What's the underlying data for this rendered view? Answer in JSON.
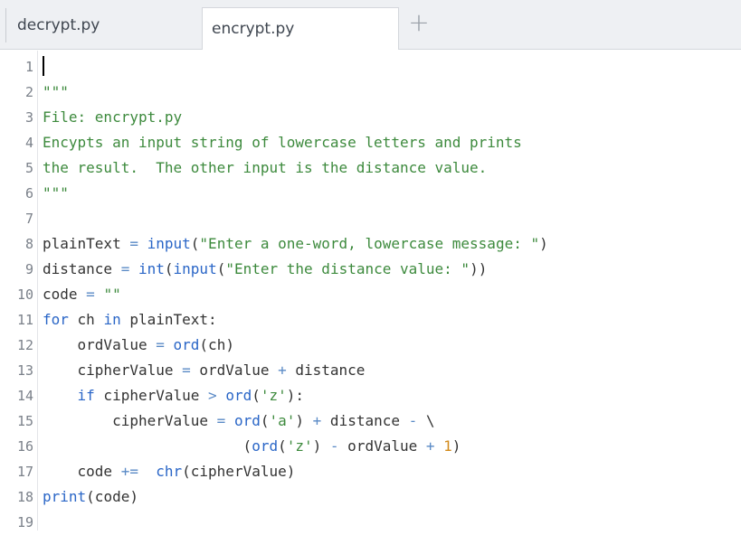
{
  "tabs": [
    {
      "label": "decrypt.py",
      "active": false
    },
    {
      "label": "encrypt.py",
      "active": true
    }
  ],
  "add_tab_icon": "plus-icon",
  "colors": {
    "keyword": "#2a66c7",
    "string": "#3d8a3d",
    "number": "#d28a1a",
    "plain": "#333333",
    "line_number": "#7b818a"
  },
  "lines": [
    {
      "n": "1",
      "tokens": []
    },
    {
      "n": "2",
      "tokens": [
        {
          "t": "\"\"\"",
          "c": "str"
        }
      ]
    },
    {
      "n": "3",
      "tokens": [
        {
          "t": "File: encrypt.py",
          "c": "str"
        }
      ]
    },
    {
      "n": "4",
      "tokens": [
        {
          "t": "Encypts an input string of lowercase letters and prints",
          "c": "str"
        }
      ]
    },
    {
      "n": "5",
      "tokens": [
        {
          "t": "the result.  The other input is the distance value.",
          "c": "str"
        }
      ]
    },
    {
      "n": "6",
      "tokens": [
        {
          "t": "\"\"\"",
          "c": "str"
        }
      ]
    },
    {
      "n": "7",
      "tokens": []
    },
    {
      "n": "8",
      "tokens": [
        {
          "t": "plainText ",
          "c": "plain"
        },
        {
          "t": "=",
          "c": "op"
        },
        {
          "t": " ",
          "c": "plain"
        },
        {
          "t": "input",
          "c": "kw"
        },
        {
          "t": "(",
          "c": "plain"
        },
        {
          "t": "\"Enter a one-word, lowercase message: \"",
          "c": "str"
        },
        {
          "t": ")",
          "c": "plain"
        }
      ]
    },
    {
      "n": "9",
      "tokens": [
        {
          "t": "distance ",
          "c": "plain"
        },
        {
          "t": "=",
          "c": "op"
        },
        {
          "t": " ",
          "c": "plain"
        },
        {
          "t": "int",
          "c": "kw"
        },
        {
          "t": "(",
          "c": "plain"
        },
        {
          "t": "input",
          "c": "kw"
        },
        {
          "t": "(",
          "c": "plain"
        },
        {
          "t": "\"Enter the distance value: \"",
          "c": "str"
        },
        {
          "t": "))",
          "c": "plain"
        }
      ]
    },
    {
      "n": "10",
      "tokens": [
        {
          "t": "code ",
          "c": "plain"
        },
        {
          "t": "=",
          "c": "op"
        },
        {
          "t": " ",
          "c": "plain"
        },
        {
          "t": "\"\"",
          "c": "str"
        }
      ]
    },
    {
      "n": "11",
      "tokens": [
        {
          "t": "for",
          "c": "kw"
        },
        {
          "t": " ch ",
          "c": "plain"
        },
        {
          "t": "in",
          "c": "kw"
        },
        {
          "t": " plainText:",
          "c": "plain"
        }
      ]
    },
    {
      "n": "12",
      "tokens": [
        {
          "t": "    ordValue ",
          "c": "plain"
        },
        {
          "t": "=",
          "c": "op"
        },
        {
          "t": " ",
          "c": "plain"
        },
        {
          "t": "ord",
          "c": "kw"
        },
        {
          "t": "(ch)",
          "c": "plain"
        }
      ]
    },
    {
      "n": "13",
      "tokens": [
        {
          "t": "    cipherValue ",
          "c": "plain"
        },
        {
          "t": "=",
          "c": "op"
        },
        {
          "t": " ordValue ",
          "c": "plain"
        },
        {
          "t": "+",
          "c": "op"
        },
        {
          "t": " distance",
          "c": "plain"
        }
      ]
    },
    {
      "n": "14",
      "tokens": [
        {
          "t": "    ",
          "c": "plain"
        },
        {
          "t": "if",
          "c": "kw"
        },
        {
          "t": " cipherValue ",
          "c": "plain"
        },
        {
          "t": ">",
          "c": "op"
        },
        {
          "t": " ",
          "c": "plain"
        },
        {
          "t": "ord",
          "c": "kw"
        },
        {
          "t": "(",
          "c": "plain"
        },
        {
          "t": "'z'",
          "c": "str"
        },
        {
          "t": "):",
          "c": "plain"
        }
      ]
    },
    {
      "n": "15",
      "tokens": [
        {
          "t": "        cipherValue ",
          "c": "plain"
        },
        {
          "t": "=",
          "c": "op"
        },
        {
          "t": " ",
          "c": "plain"
        },
        {
          "t": "ord",
          "c": "kw"
        },
        {
          "t": "(",
          "c": "plain"
        },
        {
          "t": "'a'",
          "c": "str"
        },
        {
          "t": ") ",
          "c": "plain"
        },
        {
          "t": "+",
          "c": "op"
        },
        {
          "t": " distance ",
          "c": "plain"
        },
        {
          "t": "-",
          "c": "op"
        },
        {
          "t": " \\",
          "c": "plain"
        }
      ]
    },
    {
      "n": "16",
      "tokens": [
        {
          "t": "                       (",
          "c": "plain"
        },
        {
          "t": "ord",
          "c": "kw"
        },
        {
          "t": "(",
          "c": "plain"
        },
        {
          "t": "'z'",
          "c": "str"
        },
        {
          "t": ") ",
          "c": "plain"
        },
        {
          "t": "-",
          "c": "op"
        },
        {
          "t": " ordValue ",
          "c": "plain"
        },
        {
          "t": "+",
          "c": "op"
        },
        {
          "t": " ",
          "c": "plain"
        },
        {
          "t": "1",
          "c": "num"
        },
        {
          "t": ")",
          "c": "plain"
        }
      ]
    },
    {
      "n": "17",
      "tokens": [
        {
          "t": "    code ",
          "c": "plain"
        },
        {
          "t": "+=",
          "c": "op"
        },
        {
          "t": "  ",
          "c": "plain"
        },
        {
          "t": "chr",
          "c": "kw"
        },
        {
          "t": "(cipherValue)",
          "c": "plain"
        }
      ]
    },
    {
      "n": "18",
      "tokens": [
        {
          "t": "print",
          "c": "kw"
        },
        {
          "t": "(code)",
          "c": "plain"
        }
      ]
    },
    {
      "n": "19",
      "tokens": []
    }
  ]
}
